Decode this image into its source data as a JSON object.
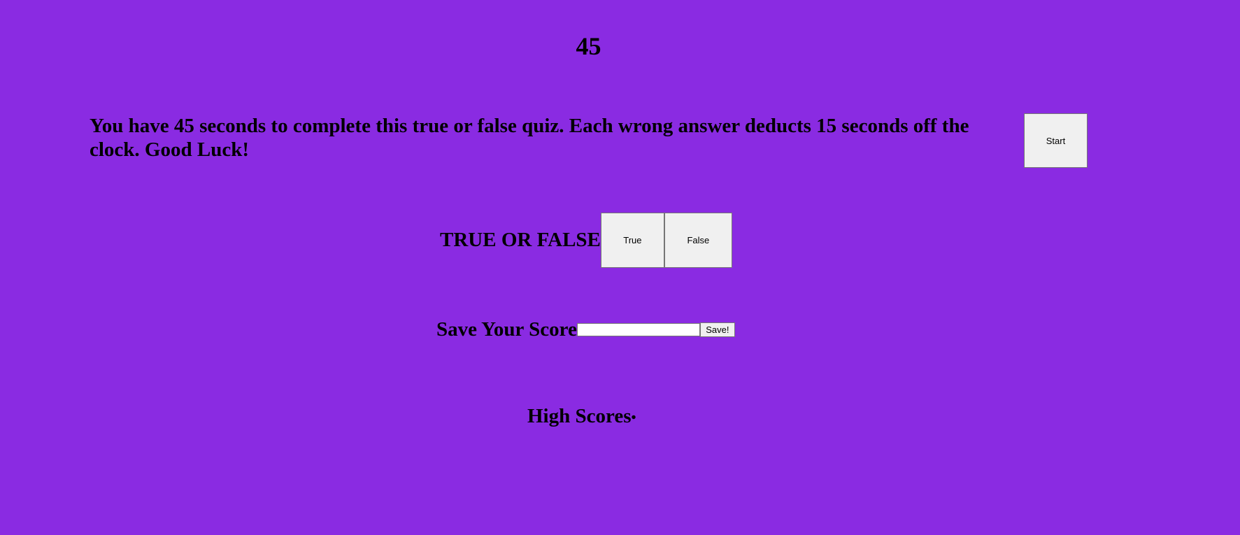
{
  "timer": {
    "seconds": "45"
  },
  "intro": {
    "text": "You have 45 seconds to complete this true or false quiz. Each wrong answer deducts 15 seconds off the clock. Good Luck!",
    "start_label": "Start"
  },
  "question": {
    "text": "TRUE OR FALSE",
    "true_label": "True",
    "false_label": "False"
  },
  "save": {
    "label": "Save Your Score",
    "input_value": "",
    "button_label": "Save!"
  },
  "highscores": {
    "title": "High Scores",
    "bullet": "•",
    "items": []
  },
  "colors": {
    "background": "#8a2be2",
    "button": "#f0f0f0"
  }
}
